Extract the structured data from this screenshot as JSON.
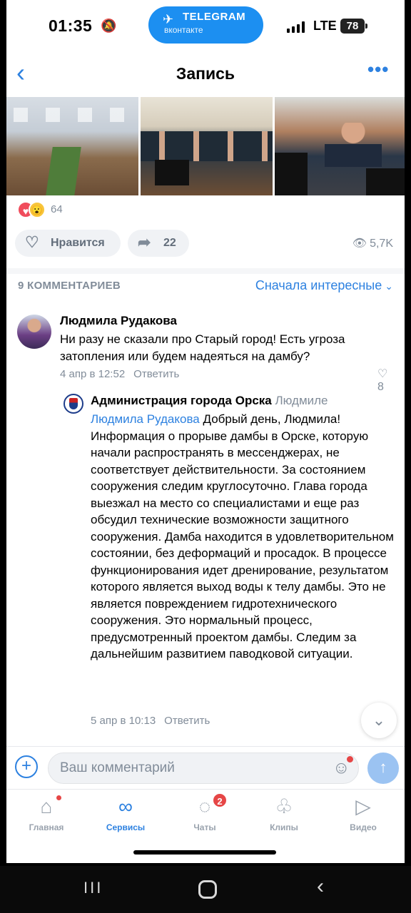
{
  "status_bar": {
    "time": "01:35",
    "dnd_icon": "bell-slash-icon",
    "network": "LTE",
    "battery": "78"
  },
  "telegram_pill": {
    "label": "TELEGRAM",
    "sub": "вконтакте"
  },
  "nav": {
    "title": "Запись"
  },
  "post": {
    "reactions_count": "64",
    "like_label": "Нравится",
    "share_count": "22",
    "views": "5,7K"
  },
  "comments": {
    "header": "9 КОММЕНТАРИЕВ",
    "sort_label": "Сначала интересные",
    "items": [
      {
        "author": "Людмила Рудакова",
        "text": "Ни разу не сказали про Старый город! Есть угроза затопления или будем надеяться на дамбу?",
        "date": "4 апр в 12:52",
        "reply_label": "Ответить",
        "likes": "8"
      },
      {
        "author": "Администрация города Орска",
        "reply_to": "Людмиле",
        "mention": "Людмила Рудакова",
        "text": "Добрый день, Людмила! Информация о прорыве дамбы в Орске, которую начали распространять в мессенджерах, не соответствует действительности. За состоянием сооружения следим круглосуточно. Глава города выезжал на место со специалистами и еще раз обсудил технические возможности защитного сооружения. Дамба находится в удовлетворительном состоянии, без деформаций и просадок. В процессе функционирования идет дренирование, результатом которого является выход воды к телу дамбы. Это не является повреждением гидротехнического сооружения. Это нормальный процесс, предусмотренный проектом дамбы. Следим за дальнейшим развитием паводковой ситуации.",
        "date": "5 апр в 10:13",
        "reply_label": "Ответить"
      }
    ]
  },
  "composer": {
    "placeholder": "Ваш комментарий"
  },
  "tabbar": {
    "home": "Главная",
    "services": "Сервисы",
    "chats": "Чаты",
    "chats_badge": "2",
    "clips": "Клипы",
    "video": "Видео"
  },
  "colors": {
    "accent": "#2d81e0",
    "secondary_text": "#818c99",
    "badge": "#e64646"
  }
}
